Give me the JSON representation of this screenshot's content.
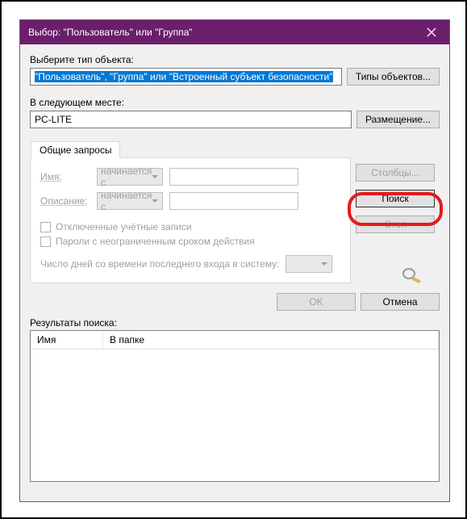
{
  "titlebar": {
    "title": "Выбор: \"Пользователь\" или \"Группа\""
  },
  "object_type": {
    "label": "Выберите тип объекта:",
    "value": "\"Пользователь\", \"Группа\" или \"Встроенный субъект безопасности\"",
    "button": "Типы объектов..."
  },
  "location": {
    "label": "В следующем месте:",
    "value": "PC-LITE",
    "button": "Размещение..."
  },
  "tab": {
    "label": "Общие запросы"
  },
  "query": {
    "name_label": "Имя:",
    "name_mode": "начинается с",
    "desc_label": "Описание:",
    "desc_mode": "начинается с",
    "chk_disabled": "Отключенные учётные записи",
    "chk_pwd": "Пароли с неограниченным сроком действия",
    "days_label": "Число дней со времени последнего входа в систему:"
  },
  "side": {
    "cols": "Столбцы...",
    "search": "Поиск",
    "stop": "Стоп"
  },
  "footer": {
    "ok": "OK",
    "cancel": "Отмена"
  },
  "results": {
    "label": "Результаты поиска:",
    "col_name": "Имя",
    "col_folder": "В папке"
  }
}
